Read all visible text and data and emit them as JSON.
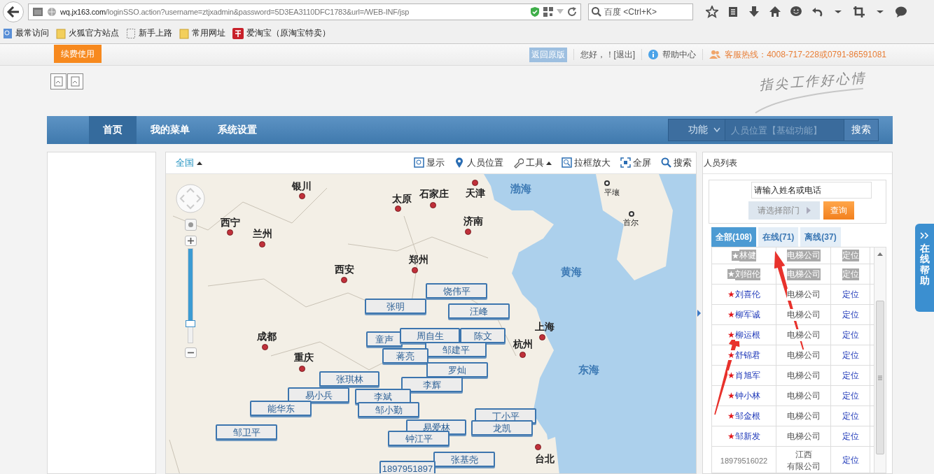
{
  "browser": {
    "url_domain": "wq.jx163.com",
    "url_path": "/loginSSO.action?username=ztjxadmin&password=5D3EA3110DFC1783&url=/WEB-INF/jsp",
    "search_placeholder": "百度 <Ctrl+K>",
    "bookmarks": [
      {
        "label": "最常访问",
        "kind": "smart"
      },
      {
        "label": "火狐官方站点",
        "kind": "folder"
      },
      {
        "label": "新手上路",
        "kind": "page"
      },
      {
        "label": "常用网址",
        "kind": "folder"
      },
      {
        "label": "爱淘宝（原淘宝特卖）",
        "kind": "shop"
      }
    ]
  },
  "topbar": {
    "renew_button": "续费使用",
    "back_link": "返回原版",
    "greeting": "您好，！[退出]",
    "help": "帮助中心",
    "hotline": "客服热线：4008-717-228或0791-86591081"
  },
  "slogan": "指尖工作好心情",
  "nav": {
    "items": [
      {
        "label": "首页",
        "selected": true
      },
      {
        "label": "我的菜单",
        "selected": false
      },
      {
        "label": "系统设置",
        "selected": false
      }
    ],
    "function_select": "功能",
    "search_placeholder": "人员位置【基础功能】",
    "search_button": "搜索"
  },
  "map": {
    "region": "全国",
    "tools": [
      {
        "label": "显示",
        "kind": "display",
        "dropdown": false
      },
      {
        "label": "人员位置",
        "kind": "location",
        "dropdown": false
      },
      {
        "label": "工具",
        "kind": "tools",
        "dropdown": true
      },
      {
        "label": "拉框放大",
        "kind": "zoombox",
        "dropdown": false
      },
      {
        "label": "全屏",
        "kind": "fullscreen",
        "dropdown": false
      },
      {
        "label": "搜索",
        "kind": "search",
        "dropdown": false
      }
    ],
    "zoom": {
      "level": 0.8
    },
    "places": [
      {
        "name": "银川",
        "kind": "city"
      },
      {
        "name": "太原",
        "kind": "city"
      },
      {
        "name": "石家庄",
        "kind": "city"
      },
      {
        "name": "天津",
        "kind": "city"
      },
      {
        "name": "渤海",
        "kind": "sea"
      },
      {
        "name": "平壤",
        "kind": "foreign"
      },
      {
        "name": "西宁",
        "kind": "city"
      },
      {
        "name": "兰州",
        "kind": "city"
      },
      {
        "name": "济南",
        "kind": "city"
      },
      {
        "name": "首尔",
        "kind": "foreign"
      },
      {
        "name": "郑州",
        "kind": "city"
      },
      {
        "name": "西安",
        "kind": "city"
      },
      {
        "name": "黄海",
        "kind": "sea"
      },
      {
        "name": "上海",
        "kind": "city"
      },
      {
        "name": "成都",
        "kind": "city"
      },
      {
        "name": "杭州",
        "kind": "city"
      },
      {
        "name": "重庆",
        "kind": "city"
      },
      {
        "name": "东海",
        "kind": "sea"
      },
      {
        "name": "台北",
        "kind": "city"
      }
    ],
    "people": [
      {
        "name": "童声"
      },
      {
        "name": "张明"
      },
      {
        "name": "饶伟平"
      },
      {
        "name": "汪峰"
      },
      {
        "name": "周自生"
      },
      {
        "name": "陈文"
      },
      {
        "name": "邹建平"
      },
      {
        "name": "蒋亮"
      },
      {
        "name": "罗灿"
      },
      {
        "name": "张琪林"
      },
      {
        "name": "李辉"
      },
      {
        "name": "易小兵"
      },
      {
        "name": "李斌"
      },
      {
        "name": "能华东"
      },
      {
        "name": "邹小勤"
      },
      {
        "name": "丁小平"
      },
      {
        "name": "龙凯"
      },
      {
        "name": "邹卫平"
      },
      {
        "name": "易爱林"
      },
      {
        "name": "钟江平"
      },
      {
        "name": "张基尧"
      },
      {
        "name": "1897951897"
      }
    ]
  },
  "people_panel": {
    "title": "人员列表",
    "search_value": "请输入姓名或电话",
    "department_button": "请选择部门",
    "query_button": "查询",
    "tabs": [
      {
        "label": "全部(108)",
        "selected": true
      },
      {
        "label": "在线(71)",
        "selected": false
      },
      {
        "label": "离线(37)",
        "selected": false
      }
    ],
    "rows": [
      {
        "kind": "member",
        "star": "★",
        "name": "林健",
        "company": "电梯公司",
        "action": "定位",
        "online": false
      },
      {
        "kind": "member",
        "star": "★",
        "name": "刘绍伦",
        "company": "电梯公司",
        "action": "定位",
        "online": false
      },
      {
        "kind": "member",
        "star": "★",
        "name": "刘喜伦",
        "company": "电梯公司",
        "action": "定位",
        "online": true
      },
      {
        "kind": "member",
        "star": "★",
        "name": "柳军诚",
        "company": "电梯公司",
        "action": "定位",
        "online": true
      },
      {
        "kind": "member",
        "star": "★",
        "name": "柳运根",
        "company": "电梯公司",
        "action": "定位",
        "online": true
      },
      {
        "kind": "member",
        "star": "★",
        "name": "舒锦君",
        "company": "电梯公司",
        "action": "定位",
        "online": true
      },
      {
        "kind": "member",
        "star": "★",
        "name": "肖旭军",
        "company": "电梯公司",
        "action": "定位",
        "online": true
      },
      {
        "kind": "member",
        "star": "★",
        "name": "钟小林",
        "company": "电梯公司",
        "action": "定位",
        "online": true
      },
      {
        "kind": "member",
        "star": "★",
        "name": "邹金根",
        "company": "电梯公司",
        "action": "定位",
        "online": true
      },
      {
        "kind": "member",
        "star": "★",
        "name": "邹新发",
        "company": "电梯公司",
        "action": "定位",
        "online": true
      },
      {
        "kind": "phone",
        "name": "18979516022",
        "company_lines": [
          "江西",
          "有限公司"
        ],
        "action": "定位"
      }
    ]
  },
  "help_tab": {
    "label": "在线帮助"
  },
  "annotations": [
    {
      "kind": "arrow"
    },
    {
      "kind": "arrow"
    }
  ]
}
